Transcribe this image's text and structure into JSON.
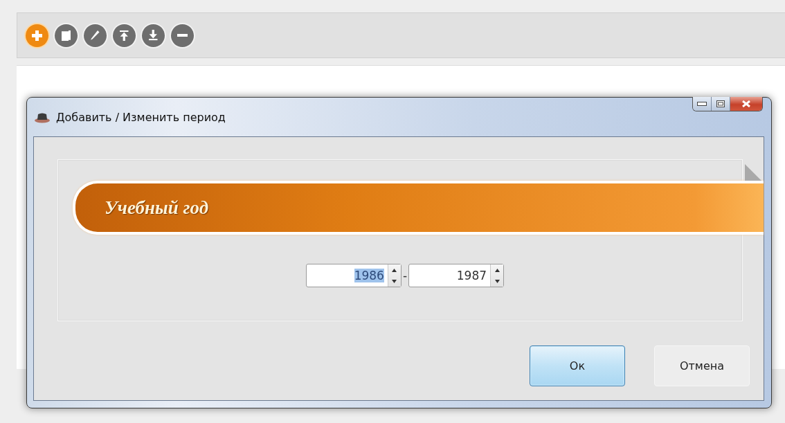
{
  "toolbar": {
    "buttons": [
      {
        "kind": "add",
        "active": true
      },
      {
        "kind": "copy",
        "active": false
      },
      {
        "kind": "edit",
        "active": false
      },
      {
        "kind": "upload",
        "active": false
      },
      {
        "kind": "download",
        "active": false
      },
      {
        "kind": "remove",
        "active": false
      }
    ]
  },
  "dialog": {
    "title": "Добавить / Изменить период",
    "section_title": "Учебный год",
    "year_from": {
      "value": "1986",
      "text_selected": true
    },
    "separator": "-",
    "year_to": {
      "value": "1987",
      "text_selected": false
    },
    "buttons": [
      {
        "label": "Ок",
        "default": true
      },
      {
        "label": "Отмена",
        "default": false
      }
    ]
  }
}
